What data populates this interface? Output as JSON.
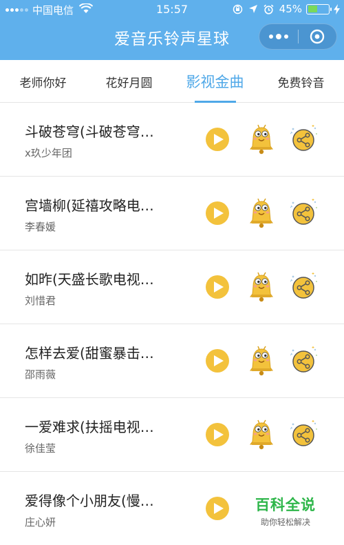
{
  "status_bar": {
    "carrier": "中国电信",
    "time": "15:57",
    "battery_percent": "45%",
    "battery_level": 0.45,
    "icons": [
      "signal-icon",
      "wifi-icon",
      "orientation-lock-icon",
      "location-icon",
      "alarm-icon",
      "battery-icon",
      "charging-icon"
    ]
  },
  "header": {
    "title": "爱音乐铃声星球",
    "background_color": "#5fb0ec"
  },
  "tabs": [
    {
      "label": "老师你好",
      "active": false
    },
    {
      "label": "花好月圆",
      "active": false
    },
    {
      "label": "影视金曲",
      "active": true
    },
    {
      "label": "免费铃音",
      "active": false
    }
  ],
  "songs": [
    {
      "title": "斗破苍穹(斗破苍穹…",
      "artist": "x玖少年团"
    },
    {
      "title": "宫墙柳(延禧攻略电…",
      "artist": "李春媛"
    },
    {
      "title": "如昨(天盛长歌电视…",
      "artist": "刘惜君"
    },
    {
      "title": "怎样去爱(甜蜜暴击…",
      "artist": "邵雨薇"
    },
    {
      "title": "一爱难求(扶摇电视…",
      "artist": "徐佳莹"
    },
    {
      "title": "爱得像个小朋友(慢…",
      "artist": "庄心妍"
    }
  ],
  "row_icons": [
    "play-icon",
    "bell-icon",
    "share-icon"
  ],
  "colors": {
    "accent": "#4fa8e8",
    "play_button": "#f3c23c"
  },
  "watermark": {
    "main": "百科全说",
    "sub": "助你轻松解决"
  }
}
